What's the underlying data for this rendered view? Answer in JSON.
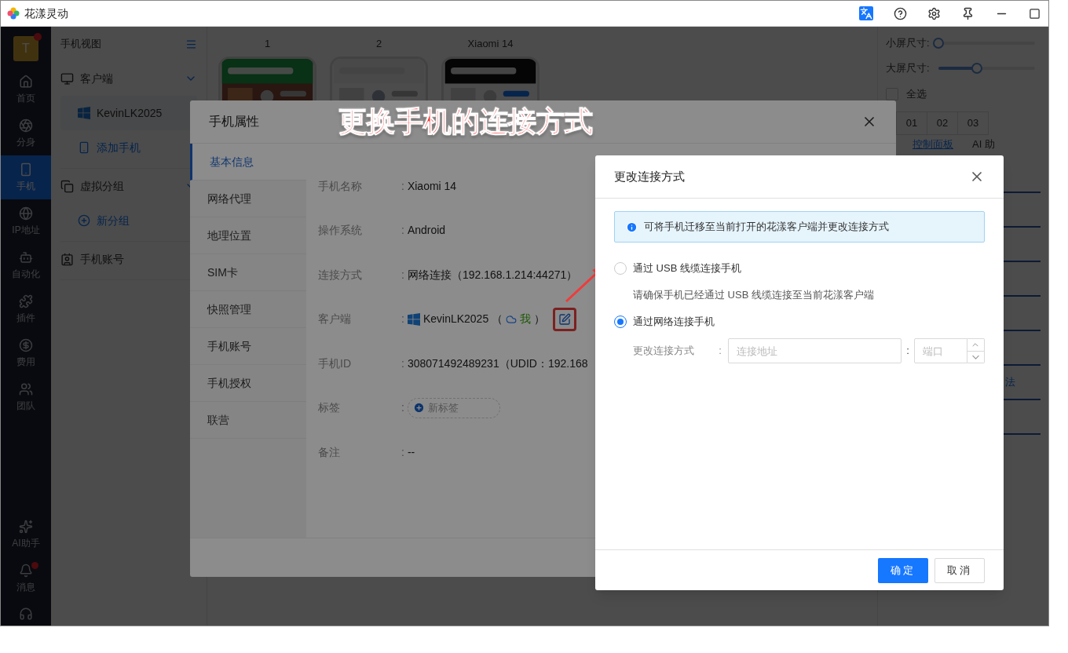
{
  "window": {
    "title": "花漾灵动"
  },
  "rail": {
    "avatar": {
      "letter": "T",
      "badge": true
    },
    "items": [
      {
        "label": "首页",
        "selected": false
      },
      {
        "label": "分身",
        "selected": false
      },
      {
        "label": "手机",
        "selected": true
      },
      {
        "label": "IP地址",
        "selected": false
      },
      {
        "label": "自动化",
        "selected": false
      },
      {
        "label": "插件",
        "selected": false
      },
      {
        "label": "费用",
        "selected": false
      },
      {
        "label": "团队",
        "selected": false
      }
    ],
    "bottom_items": [
      {
        "label": "AI助手",
        "badge": false
      },
      {
        "label": "消息",
        "badge": true
      }
    ]
  },
  "sidebar": {
    "title": "手机视图",
    "groups": [
      {
        "label": "客户端",
        "expanded": true,
        "children": [
          {
            "label": "KevinLK2025",
            "kind": "client",
            "selected": true
          },
          {
            "label": "添加手机",
            "kind": "add",
            "selected": false
          }
        ]
      },
      {
        "label": "虚拟分组",
        "expanded": true,
        "children": [
          {
            "label": "新分组",
            "kind": "add",
            "selected": false
          }
        ]
      },
      {
        "label": "手机账号"
      }
    ]
  },
  "phones": [
    {
      "label": "1"
    },
    {
      "label": "2"
    },
    {
      "label": "Xiaomi 14"
    }
  ],
  "right_panel": {
    "sliders": [
      {
        "label": "小屏尺寸:",
        "level": 0
      },
      {
        "label": "大屏尺寸:",
        "level": 0.4
      }
    ],
    "select_all": {
      "label": "全选",
      "checked": false
    },
    "screens": [
      "01",
      "02",
      "03"
    ],
    "tabs": [
      {
        "label": "控制面板",
        "selected": true
      },
      {
        "label": "AI 助",
        "selected": false
      }
    ],
    "fragment": "法"
  },
  "properties_modal": {
    "title": "手机属性",
    "tabs": [
      {
        "label": "基本信息",
        "selected": true
      },
      {
        "label": "网络代理",
        "selected": false
      },
      {
        "label": "地理位置",
        "selected": false
      },
      {
        "label": "SIM卡",
        "selected": false
      },
      {
        "label": "快照管理",
        "selected": false
      },
      {
        "label": "手机账号",
        "selected": false
      },
      {
        "label": "手机授权",
        "selected": false
      },
      {
        "label": "联营",
        "selected": false
      }
    ],
    "fields": [
      {
        "label": "手机名称",
        "colon": ":",
        "kind": "text",
        "value": "Xiaomi 14"
      },
      {
        "label": "操作系统",
        "colon": ":",
        "kind": "text",
        "value": "Android"
      },
      {
        "label": "连接方式",
        "colon": ":",
        "kind": "text",
        "value": "网络连接（192.168.1.214:44271）"
      },
      {
        "label": "客户端",
        "colon": ":",
        "kind": "client",
        "value": "KevinLK2025",
        "paren_open": "（",
        "owner": "我",
        "paren_close": "）"
      },
      {
        "label": "手机ID",
        "colon": ":",
        "kind": "text",
        "value": "308071492489231（UDID：192.168"
      },
      {
        "label": "标签",
        "colon": ":",
        "kind": "tag",
        "value": "新标签"
      },
      {
        "label": "备注",
        "colon": ":",
        "kind": "text",
        "value": "--"
      }
    ]
  },
  "annotation": {
    "text": "更换手机的连接方式"
  },
  "dialog": {
    "title": "更改连接方式",
    "alert": "可将手机迁移至当前打开的花漾客户端并更改连接方式",
    "options": [
      {
        "label": "通过 USB 线缆连接手机",
        "selected": false,
        "hint": "请确保手机已经通过 USB 线缆连接至当前花漾客户端"
      },
      {
        "label": "通过网络连接手机",
        "selected": true
      }
    ],
    "form": {
      "label": "更改连接方式",
      "colon": ":",
      "address_placeholder": "连接地址",
      "separator": ":",
      "port_placeholder": "端口"
    },
    "buttons": [
      {
        "label": "确定",
        "kind": "primary"
      },
      {
        "label": "取消",
        "kind": "default"
      }
    ]
  }
}
